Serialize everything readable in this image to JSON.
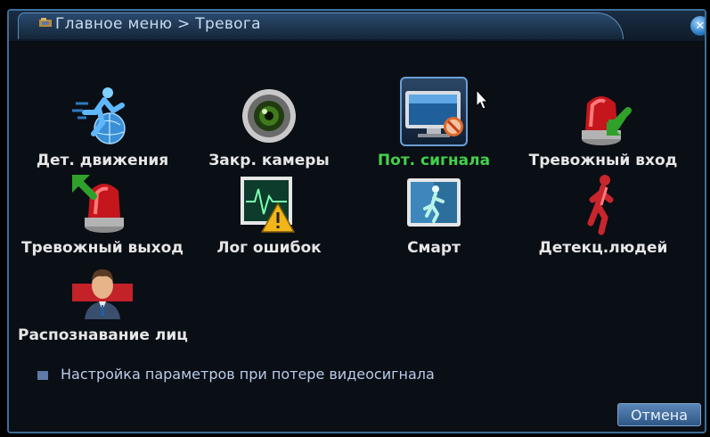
{
  "window": {
    "breadcrumb": "Главное меню > Тревога",
    "close_label": "✕"
  },
  "menu_items": [
    {
      "label": "Дет. движения",
      "icon": "motion-detection-icon",
      "selected": false
    },
    {
      "label": "Закр. камеры",
      "icon": "camera-blind-icon",
      "selected": false
    },
    {
      "label": "Пот. сигнала",
      "icon": "video-loss-icon",
      "selected": true
    },
    {
      "label": "Тревожный вход",
      "icon": "alarm-input-icon",
      "selected": false
    },
    {
      "label": "Тревожный выход",
      "icon": "alarm-output-icon",
      "selected": false
    },
    {
      "label": "Лог ошибок",
      "icon": "error-log-icon",
      "selected": false
    },
    {
      "label": "Смарт",
      "icon": "smart-icon",
      "selected": false
    },
    {
      "label": "Детекц.людей",
      "icon": "human-detection-icon",
      "selected": false
    },
    {
      "label": "Распознавание лиц",
      "icon": "face-recognition-icon",
      "selected": false
    }
  ],
  "status_text": "Настройка параметров при потере видеосигнала",
  "buttons": {
    "cancel_label": "Отмена"
  },
  "colors": {
    "selected_label": "#43d14a",
    "label": "#e6e6e6",
    "accent_blue": "#3d6e9a"
  }
}
